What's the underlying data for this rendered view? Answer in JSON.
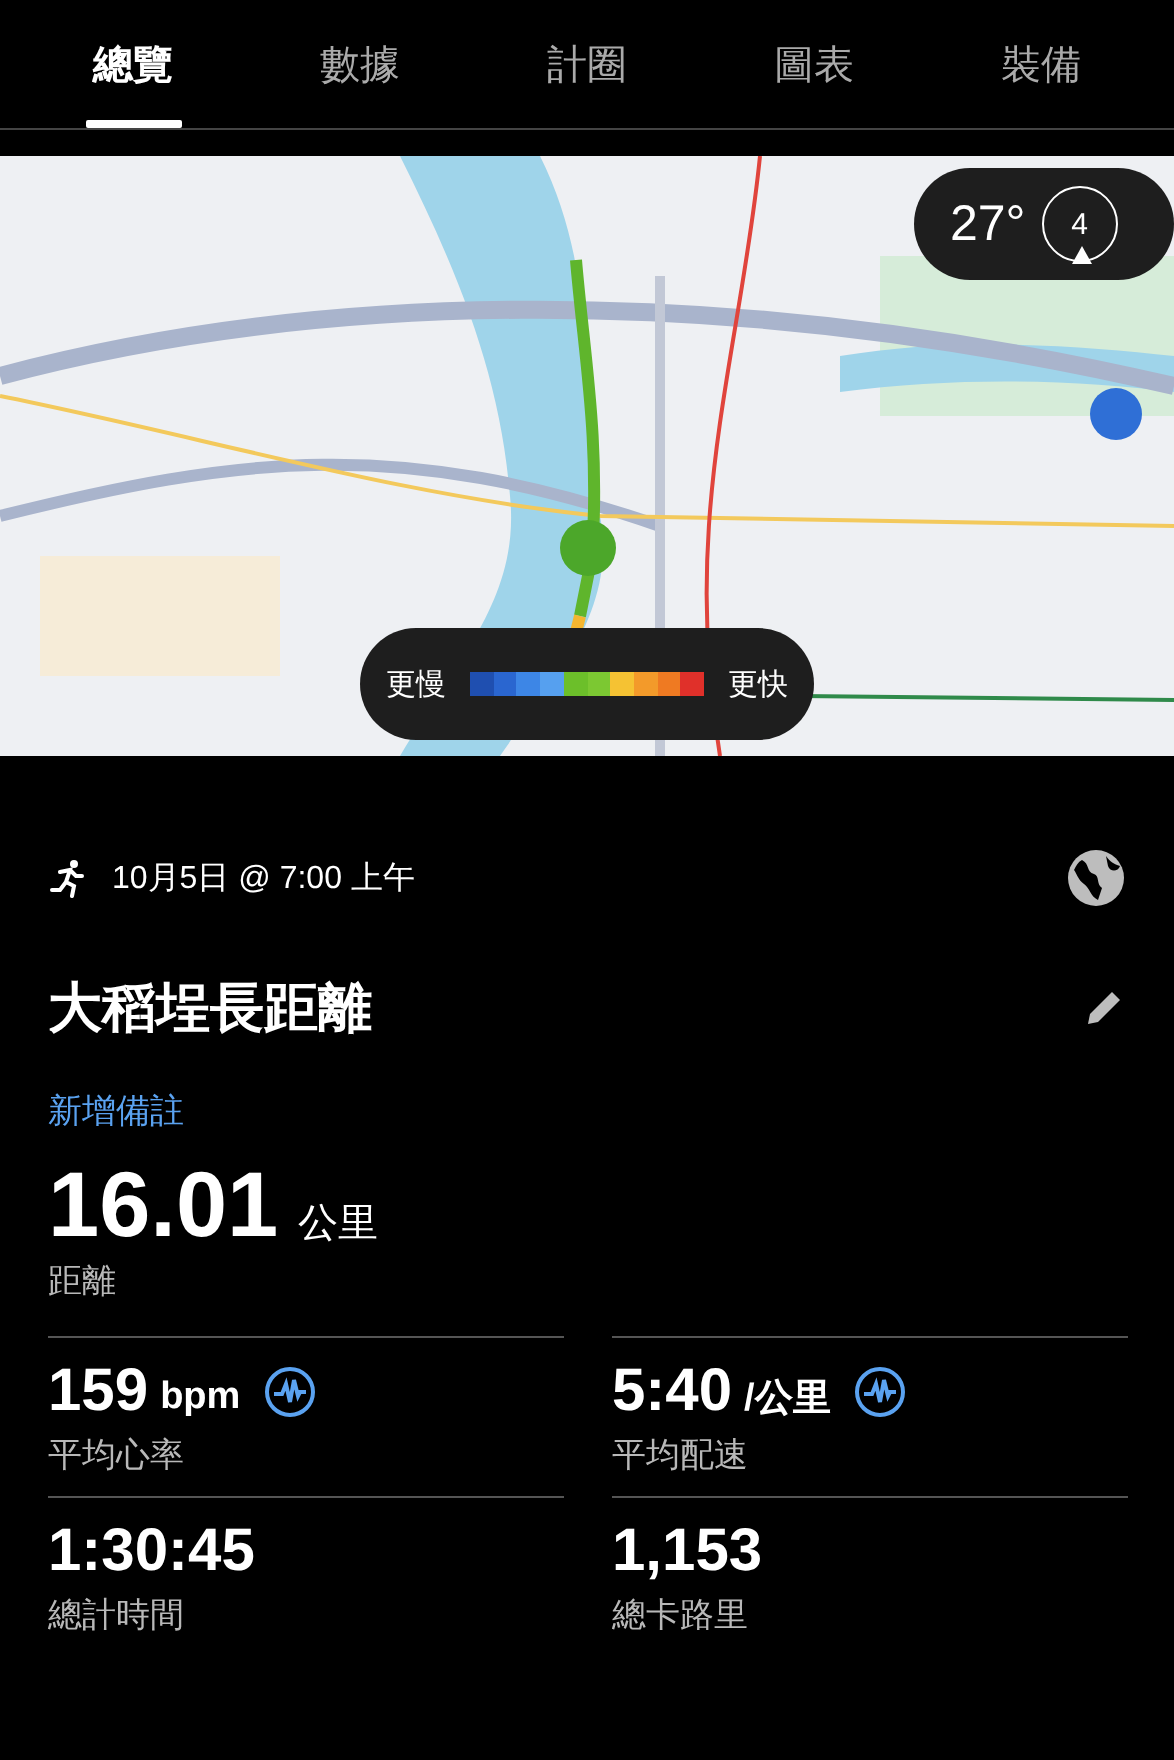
{
  "tabs": [
    {
      "label": "總覽",
      "selected": true
    },
    {
      "label": "數據",
      "selected": false
    },
    {
      "label": "計圈",
      "selected": false
    },
    {
      "label": "圖表",
      "selected": false
    },
    {
      "label": "裝備",
      "selected": false
    }
  ],
  "map": {
    "weather": {
      "temperature": "27°",
      "wind": "4"
    },
    "legend": {
      "slow_label": "更慢",
      "fast_label": "更快",
      "swatches": [
        {
          "color": "#1f4fb0"
        },
        {
          "color": "#2a66d0"
        },
        {
          "color": "#3d86e6"
        },
        {
          "color": "#56a0ef"
        },
        {
          "color": "#6cbf2a"
        },
        {
          "color": "#7cc832"
        },
        {
          "color": "#f5c233"
        },
        {
          "color": "#f39a2a"
        },
        {
          "color": "#ef7a22"
        },
        {
          "color": "#e0302a"
        }
      ]
    }
  },
  "activity": {
    "date": "10月5日 @ 7:00 上午",
    "title": "大稻埕長距離",
    "add_note": "新增備註",
    "distance": {
      "value": "16.01",
      "unit": "公里",
      "label": "距離"
    },
    "stats": [
      {
        "value": "159",
        "unit": "bpm",
        "label": "平均心率",
        "graph_link": true
      },
      {
        "value": "5:40",
        "unit": "/公里",
        "label": "平均配速",
        "graph_link": true
      },
      {
        "value": "1:30:45",
        "label": "總計時間",
        "graph_link": false
      },
      {
        "value": "1,153",
        "label": "總卡路里",
        "graph_link": false
      }
    ]
  }
}
